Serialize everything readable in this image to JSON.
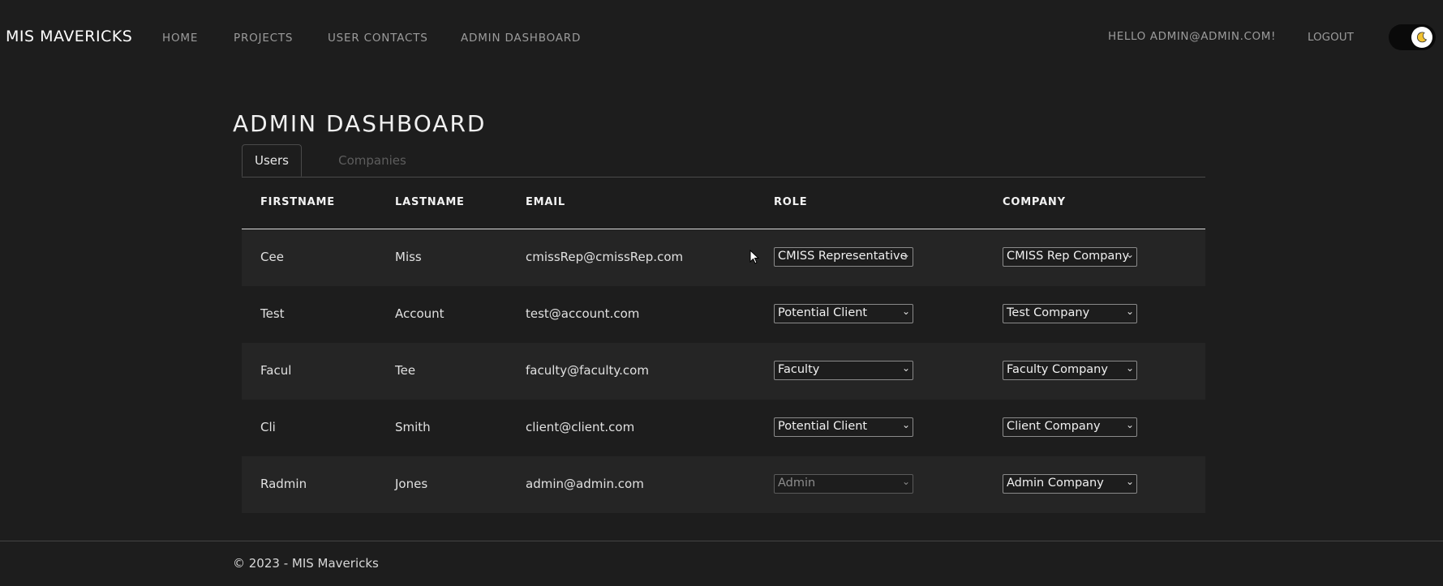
{
  "nav": {
    "brand": "MIS MAVERICKS",
    "links": [
      "HOME",
      "PROJECTS",
      "USER CONTACTS",
      "ADMIN DASHBOARD"
    ],
    "greeting": "HELLO ADMIN@ADMIN.COM!",
    "logout": "LOGOUT",
    "theme_toggle_icon": "moon-icon"
  },
  "page": {
    "title": "ADMIN DASHBOARD",
    "tabs": [
      {
        "label": "Users",
        "active": true
      },
      {
        "label": "Companies",
        "active": false
      }
    ]
  },
  "table": {
    "headers": [
      "FIRSTNAME",
      "LASTNAME",
      "EMAIL",
      "ROLE",
      "COMPANY"
    ],
    "rows": [
      {
        "firstname": "Cee",
        "lastname": "Miss",
        "email": "cmissRep@cmissRep.com",
        "role": "CMISS Representative",
        "company": "CMISS Rep Company",
        "role_disabled": false
      },
      {
        "firstname": "Test",
        "lastname": "Account",
        "email": "test@account.com",
        "role": "Potential Client",
        "company": "Test Company",
        "role_disabled": false
      },
      {
        "firstname": "Facul",
        "lastname": "Tee",
        "email": "faculty@faculty.com",
        "role": "Faculty",
        "company": "Faculty Company",
        "role_disabled": false
      },
      {
        "firstname": "Cli",
        "lastname": "Smith",
        "email": "client@client.com",
        "role": "Potential Client",
        "company": "Client Company",
        "role_disabled": false
      },
      {
        "firstname": "Radmin",
        "lastname": "Jones",
        "email": "admin@admin.com",
        "role": "Admin",
        "company": "Admin Company",
        "role_disabled": true
      }
    ]
  },
  "footer": {
    "text": "© 2023 - MIS Mavericks"
  },
  "colors": {
    "background": "#1d1d1d",
    "row_shade": "#252525",
    "nav_text": "#9b9b9b",
    "inactive_tab": "#5d5d5d"
  }
}
